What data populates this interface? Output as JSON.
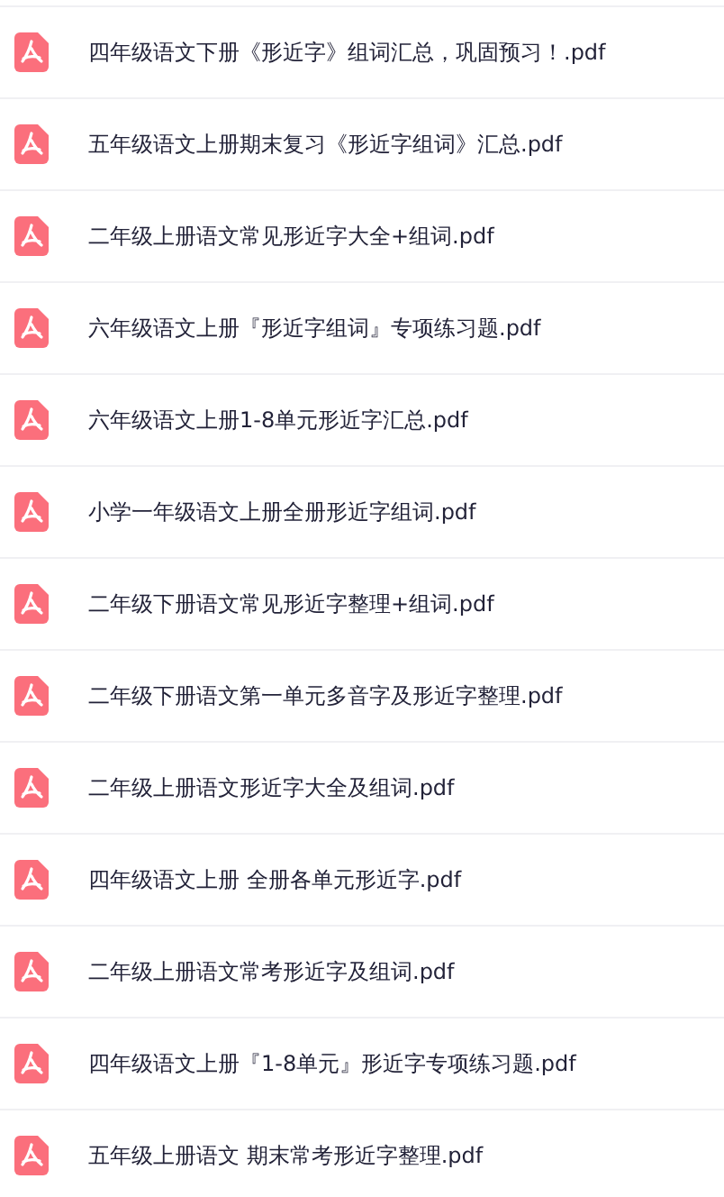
{
  "files": [
    {
      "name": "四年级语文下册《形近字》组词汇总，巩固预习！.pdf",
      "kind": "pdf"
    },
    {
      "name": "五年级语文上册期末复习《形近字组词》汇总.pdf",
      "kind": "pdf"
    },
    {
      "name": "二年级上册语文常见形近字大全+组词.pdf",
      "kind": "pdf"
    },
    {
      "name": "六年级语文上册『形近字组词』专项练习题.pdf",
      "kind": "pdf"
    },
    {
      "name": "六年级语文上册1-8单元形近字汇总.pdf",
      "kind": "pdf"
    },
    {
      "name": "小学一年级语文上册全册形近字组词.pdf",
      "kind": "pdf"
    },
    {
      "name": "二年级下册语文常见形近字整理+组词.pdf",
      "kind": "pdf"
    },
    {
      "name": "二年级下册语文第一单元多音字及形近字整理.pdf",
      "kind": "pdf"
    },
    {
      "name": "二年级上册语文形近字大全及组词.pdf",
      "kind": "pdf"
    },
    {
      "name": "四年级语文上册 全册各单元形近字.pdf",
      "kind": "pdf"
    },
    {
      "name": "二年级上册语文常考形近字及组词.pdf",
      "kind": "pdf"
    },
    {
      "name": "四年级语文上册『1-8单元』形近字专项练习题.pdf",
      "kind": "pdf"
    },
    {
      "name": "五年级上册语文 期末常考形近字整理.pdf",
      "kind": "pdf"
    }
  ]
}
